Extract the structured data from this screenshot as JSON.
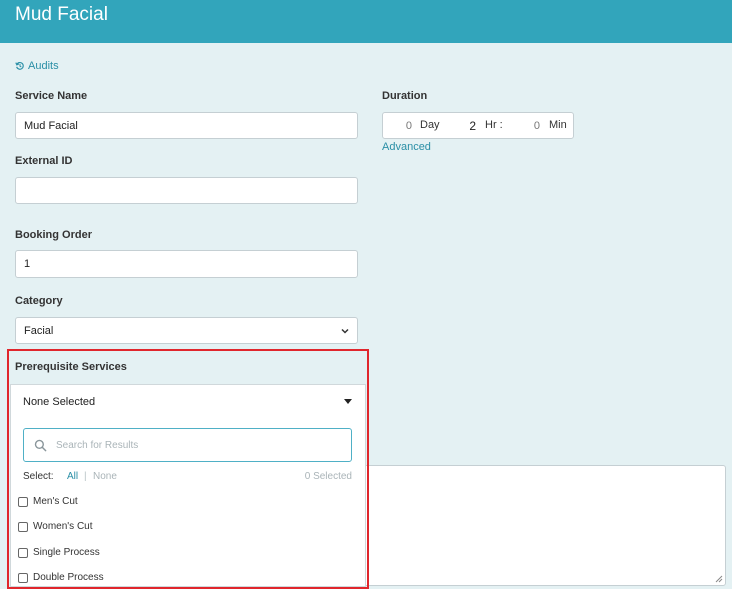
{
  "header": {
    "title": "Mud Facial"
  },
  "audits": {
    "label": "Audits",
    "icon": "history-icon"
  },
  "service_name": {
    "label": "Service Name",
    "value": "Mud Facial"
  },
  "external_id": {
    "label": "External ID",
    "value": ""
  },
  "booking_order": {
    "label": "Booking Order",
    "value": "1"
  },
  "category": {
    "label": "Category",
    "value": "Facial"
  },
  "duration": {
    "label": "Duration",
    "days": "0",
    "day_unit": "Day",
    "hours": "2",
    "hour_unit": "Hr :",
    "minutes": "0",
    "minute_unit": "Min",
    "advanced_label": "Advanced"
  },
  "prerequisite": {
    "label": "Prerequisite Services",
    "selected_text": "None Selected",
    "search_placeholder": "Search for Results",
    "select_label": "Select:",
    "all_label": "All",
    "separator": "|",
    "none_label": "None",
    "selected_count": "0 Selected",
    "options": [
      "Men's Cut",
      "Women's Cut",
      "Single Process",
      "Double Process"
    ]
  },
  "colors": {
    "header": "#32a5bb",
    "accent": "#2a8fa6",
    "highlight": "#e0262c",
    "background": "#e4f1f3"
  }
}
